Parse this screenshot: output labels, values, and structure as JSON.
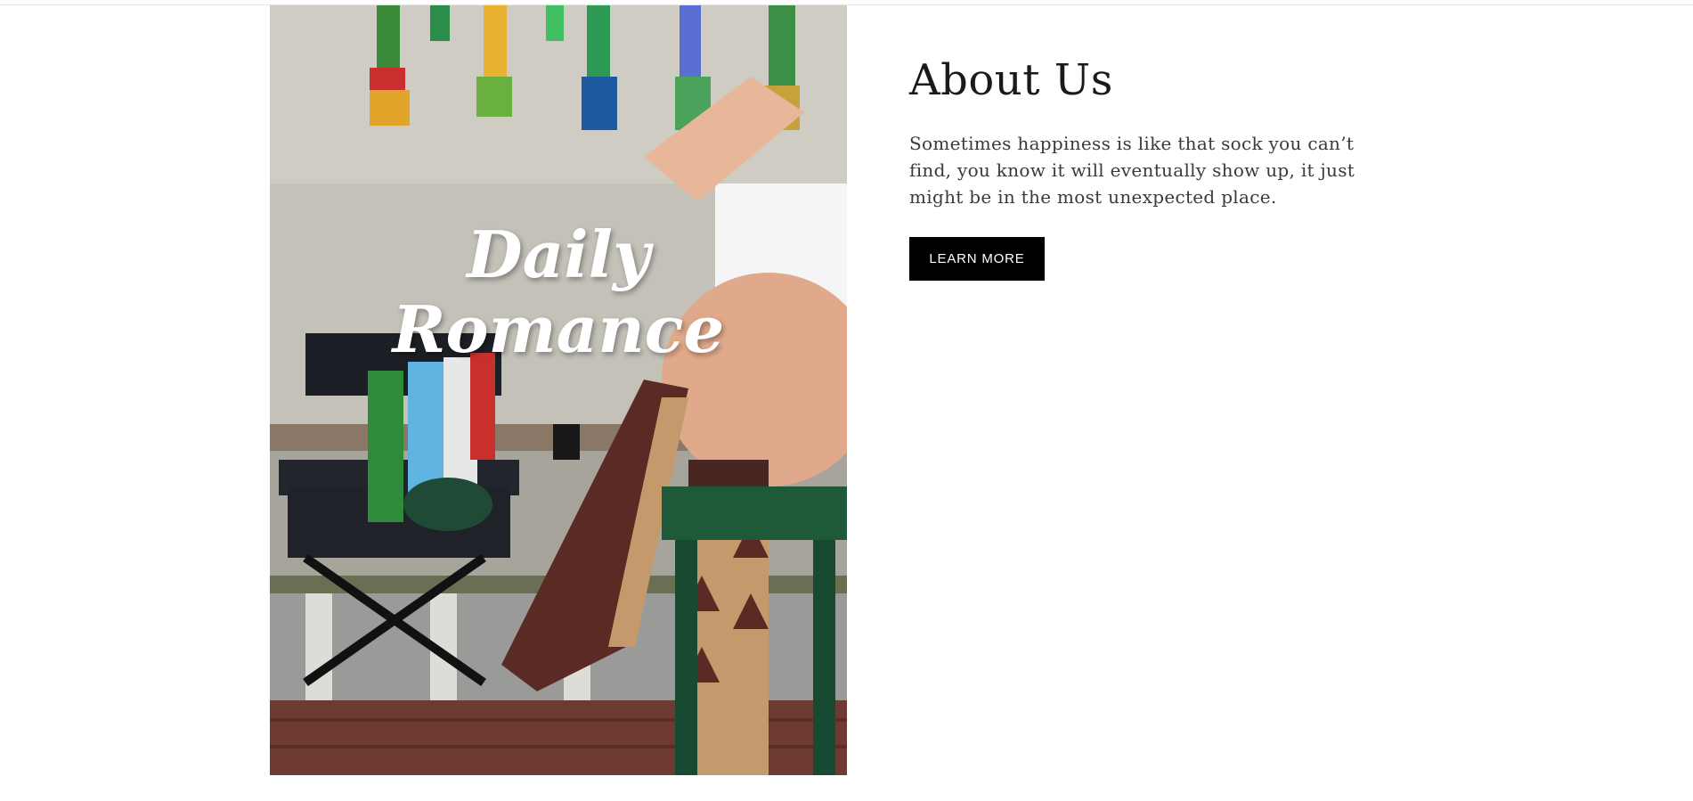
{
  "hero": {
    "overlay_line1": "Daily",
    "overlay_line2": "Romance"
  },
  "about": {
    "title": "About Us",
    "text": "Sometimes happiness is like that sock you can’t find, you know it will eventually show up, it just might be in the most unexpected place.",
    "button_label": "LEARN MORE"
  },
  "colors": {
    "button_bg": "#000000",
    "button_text": "#ffffff",
    "heading": "#1a1a1a",
    "body_text": "#3a3a3a"
  }
}
